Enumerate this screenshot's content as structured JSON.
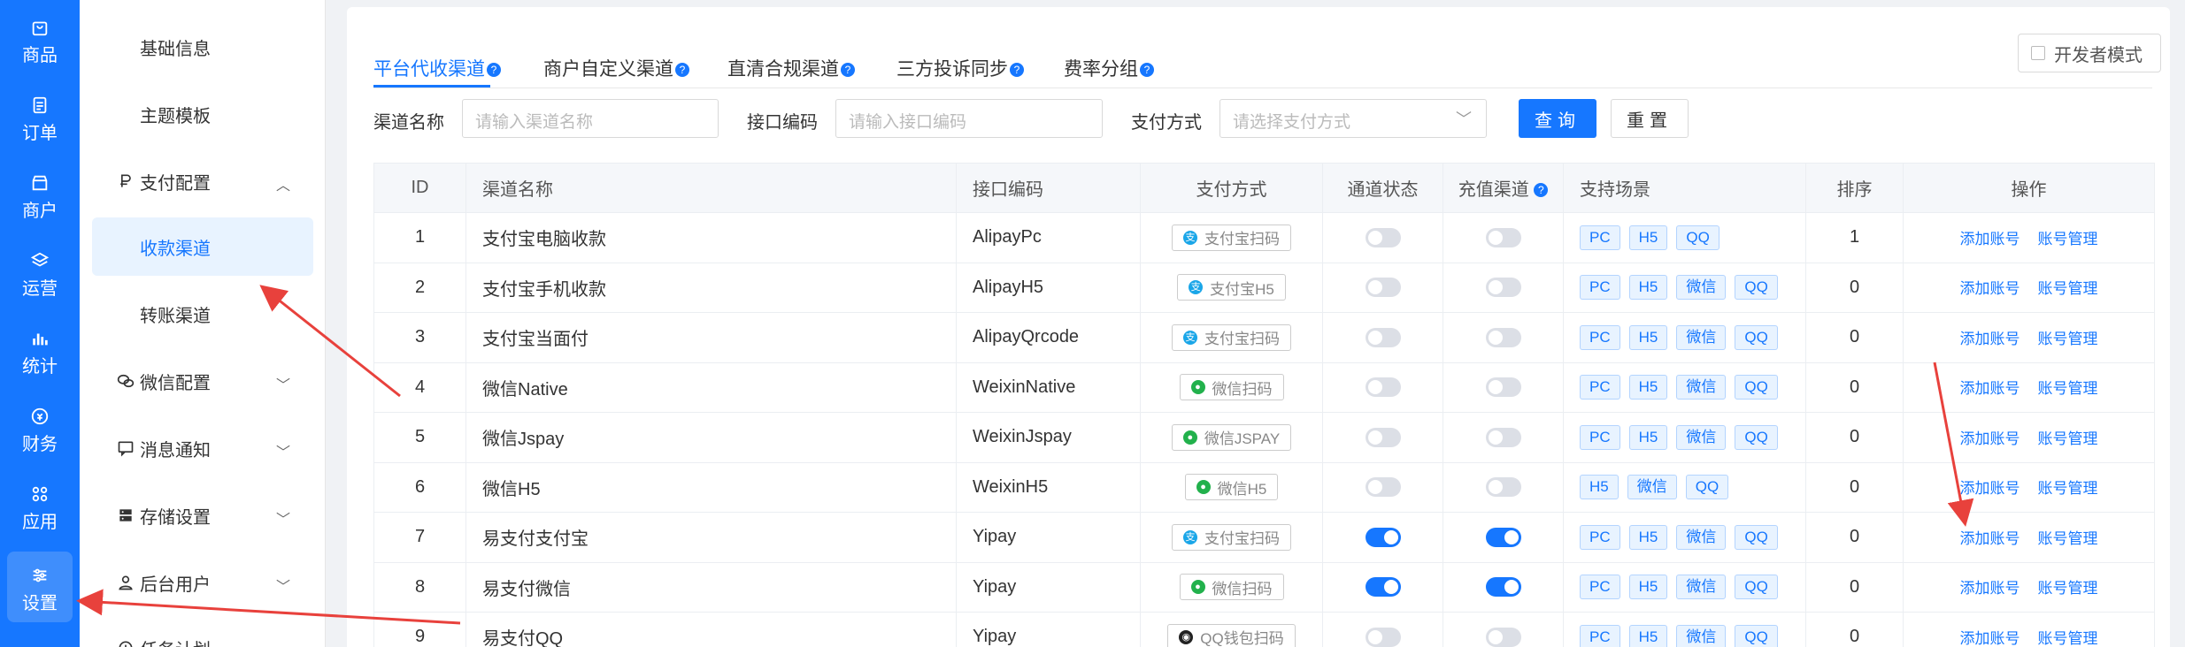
{
  "rail": {
    "items": [
      {
        "label": "商品",
        "icon": "bag-icon"
      },
      {
        "label": "订单",
        "icon": "order-icon"
      },
      {
        "label": "商户",
        "icon": "shop-icon"
      },
      {
        "label": "运营",
        "icon": "layers-icon"
      },
      {
        "label": "统计",
        "icon": "bar-chart-icon"
      },
      {
        "label": "财务",
        "icon": "coin-icon"
      },
      {
        "label": "应用",
        "icon": "grid-icon"
      },
      {
        "label": "设置",
        "icon": "sliders-icon"
      }
    ]
  },
  "subnav": {
    "basic_info": "基础信息",
    "theme_template": "主题模板",
    "payment_config": "支付配置",
    "collect_channel": "收款渠道",
    "transfer_channel": "转账渠道",
    "wechat_config": "微信配置",
    "message_notify": "消息通知",
    "storage_settings": "存储设置",
    "admin_users": "后台用户",
    "task_plan": "任务计划"
  },
  "tabs": {
    "t1": "平台代收渠道",
    "t2": "商户自定义渠道",
    "t3": "直清合规渠道",
    "t4": "三方投诉同步",
    "t5": "费率分组",
    "dev_mode": "开发者模式"
  },
  "filters": {
    "channel_name_label": "渠道名称",
    "channel_name_placeholder": "请输入渠道名称",
    "interface_code_label": "接口编码",
    "interface_code_placeholder": "请输入接口编码",
    "pay_method_label": "支付方式",
    "pay_method_placeholder": "请选择支付方式",
    "query": "查询",
    "reset": "重置"
  },
  "table": {
    "headers": {
      "id": "ID",
      "name": "渠道名称",
      "code": "接口编码",
      "method": "支付方式",
      "status": "通道状态",
      "recharge": "充值渠道",
      "scenes": "支持场景",
      "sort": "排序",
      "ops": "操作"
    },
    "ops": {
      "add": "添加账号",
      "manage": "账号管理"
    },
    "rows": [
      {
        "id": "1",
        "name": "支付宝电脑收款",
        "code": "AlipayPc",
        "method": "支付宝扫码",
        "method_icon": "alipay",
        "status": false,
        "recharge": false,
        "scenes": [
          "PC",
          "H5",
          "QQ"
        ],
        "sort": "1"
      },
      {
        "id": "2",
        "name": "支付宝手机收款",
        "code": "AlipayH5",
        "method": "支付宝H5",
        "method_icon": "alipay",
        "status": false,
        "recharge": false,
        "scenes": [
          "PC",
          "H5",
          "微信",
          "QQ"
        ],
        "sort": "0"
      },
      {
        "id": "3",
        "name": "支付宝当面付",
        "code": "AlipayQrcode",
        "method": "支付宝扫码",
        "method_icon": "alipay",
        "status": false,
        "recharge": false,
        "scenes": [
          "PC",
          "H5",
          "微信",
          "QQ"
        ],
        "sort": "0"
      },
      {
        "id": "4",
        "name": "微信Native",
        "code": "WeixinNative",
        "method": "微信扫码",
        "method_icon": "wechat",
        "status": false,
        "recharge": false,
        "scenes": [
          "PC",
          "H5",
          "微信",
          "QQ"
        ],
        "sort": "0"
      },
      {
        "id": "5",
        "name": "微信Jspay",
        "code": "WeixinJspay",
        "method": "微信JSPAY",
        "method_icon": "wechat",
        "status": false,
        "recharge": false,
        "scenes": [
          "PC",
          "H5",
          "微信",
          "QQ"
        ],
        "sort": "0"
      },
      {
        "id": "6",
        "name": "微信H5",
        "code": "WeixinH5",
        "method": "微信H5",
        "method_icon": "wechat",
        "status": false,
        "recharge": false,
        "scenes": [
          "H5",
          "微信",
          "QQ"
        ],
        "sort": "0"
      },
      {
        "id": "7",
        "name": "易支付支付宝",
        "code": "Yipay",
        "method": "支付宝扫码",
        "method_icon": "alipay",
        "status": true,
        "recharge": true,
        "scenes": [
          "PC",
          "H5",
          "微信",
          "QQ"
        ],
        "sort": "0"
      },
      {
        "id": "8",
        "name": "易支付微信",
        "code": "Yipay",
        "method": "微信扫码",
        "method_icon": "wechat",
        "status": true,
        "recharge": true,
        "scenes": [
          "PC",
          "H5",
          "微信",
          "QQ"
        ],
        "sort": "0"
      },
      {
        "id": "9",
        "name": "易支付QQ",
        "code": "Yipay",
        "method": "QQ钱包扫码",
        "method_icon": "qq",
        "status": false,
        "recharge": false,
        "scenes": [
          "PC",
          "H5",
          "微信",
          "QQ"
        ],
        "sort": "0"
      }
    ]
  },
  "colors": {
    "primary": "#1677ff",
    "annotation": "#e8413c"
  }
}
